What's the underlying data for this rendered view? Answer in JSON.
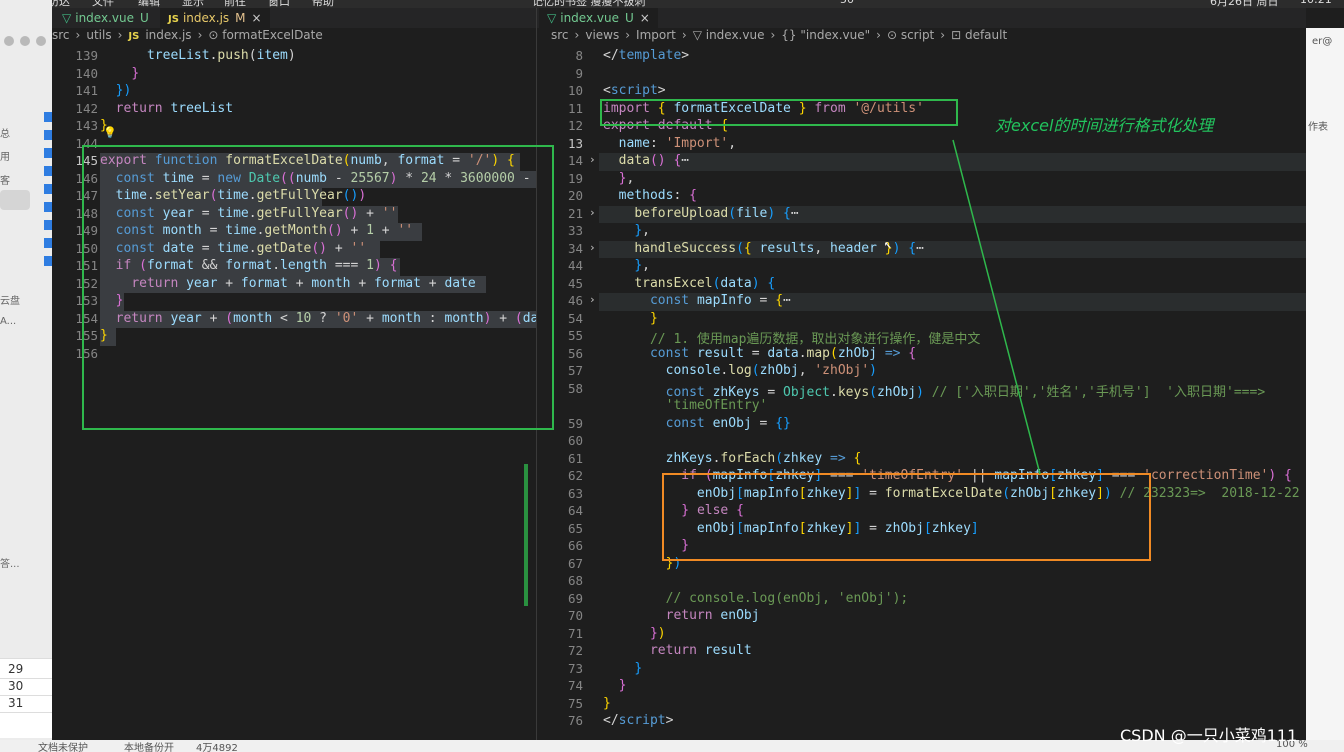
{
  "menubar": {
    "items": [
      "",
      "访达",
      "文件",
      "编辑",
      "显示",
      "前往",
      "窗口",
      "帮助",
      "记忆的书签 瘦瘦不拔刺",
      "50",
      "6月26日 周日",
      "10:21"
    ]
  },
  "left_bg_app": {
    "side_labels": [
      "总",
      "用",
      "客",
      "云盘",
      "A...",
      "答..."
    ],
    "row_numbers": [
      "29",
      "30",
      "31"
    ]
  },
  "right_bg_app": {
    "label_top": "er@",
    "label_mid": "作表"
  },
  "left_pane": {
    "tabs": [
      {
        "icon": "vue-icon",
        "label": "index.vue",
        "mod": "U"
      },
      {
        "icon": "js-icon",
        "label": "index.js",
        "mod": "M",
        "close": "×"
      }
    ],
    "breadcrumb": [
      "src",
      "›",
      "utils",
      "›",
      "JS",
      "index.js",
      "›",
      "⊙ formatExcelDate"
    ]
  },
  "right_pane": {
    "tabs": [
      {
        "icon": "vue-icon",
        "label": "index.vue",
        "mod": "U",
        "close": "×"
      }
    ],
    "breadcrumb": [
      "src",
      "›",
      "views",
      "›",
      "Import",
      "›",
      "▽ index.vue",
      "›",
      "{} \"index.vue\"",
      "›",
      "⊙ script",
      "›",
      "⊡ default"
    ]
  },
  "annotation": "对excel的时间进行格式化处理",
  "watermark": "CSDN @一只小菜鸡111",
  "statusbar": {
    "items": [
      "文档未保护",
      "本地备份开",
      "4万4892",
      "100 %"
    ]
  },
  "left_code": [
    {
      "n": "139",
      "html": "      <span class=\"vr\">treeList</span>.<span class=\"fn\">push</span>(<span class=\"vr\">item</span>)"
    },
    {
      "n": "140",
      "html": "    <span class=\"br2\">}</span>"
    },
    {
      "n": "141",
      "html": "  <span class=\"br3\">})</span>"
    },
    {
      "n": "142",
      "html": "  <span class=\"kw2\">return</span> <span class=\"vr\">treeList</span>"
    },
    {
      "n": "143",
      "html": "<span class=\"br\">}</span>"
    },
    {
      "n": "144",
      "html": ""
    },
    {
      "n": "145",
      "html": "<span class=\"kw2\">export</span> <span class=\"kw\">function</span> <span class=\"fn\">formatExcelDate</span><span class=\"br\">(</span><span class=\"vr\">numb</span>, <span class=\"vr\">format</span> = <span class=\"str\">'/'</span><span class=\"br\">)</span> <span class=\"br\">{</span>"
    },
    {
      "n": "146",
      "html": "  <span class=\"kw\">const</span> <span class=\"vr\">time</span> = <span class=\"kw\">new</span> <span class=\"cls\">Date</span><span class=\"br2\">((</span><span class=\"vr\">numb</span> - <span class=\"num\">25567</span><span class=\"br2\">)</span> * <span class=\"num\">24</span> * <span class=\"num\">3600000</span> -"
    },
    {
      "n": "147",
      "html": "  <span class=\"vr\">time</span>.<span class=\"fn\">setYear</span><span class=\"br2\">(</span><span class=\"vr\">time</span>.<span class=\"fn\">getFullYear</span><span class=\"br3\">()</span><span class=\"br2\">)</span>"
    },
    {
      "n": "148",
      "html": "  <span class=\"kw\">const</span> <span class=\"vr\">year</span> = <span class=\"vr\">time</span>.<span class=\"fn\">getFullYear</span><span class=\"br2\">()</span> + <span class=\"str\">''</span>"
    },
    {
      "n": "149",
      "html": "  <span class=\"kw\">const</span> <span class=\"vr\">month</span> = <span class=\"vr\">time</span>.<span class=\"fn\">getMonth</span><span class=\"br2\">()</span> + <span class=\"num\">1</span> + <span class=\"str\">''</span>"
    },
    {
      "n": "150",
      "html": "  <span class=\"kw\">const</span> <span class=\"vr\">date</span> = <span class=\"vr\">time</span>.<span class=\"fn\">getDate</span><span class=\"br2\">()</span> + <span class=\"str\">''</span>"
    },
    {
      "n": "151",
      "html": "  <span class=\"kw2\">if</span> <span class=\"br2\">(</span><span class=\"vr\">format</span> &amp;&amp; <span class=\"vr\">format</span>.<span class=\"vr\">length</span> === <span class=\"num\">1</span><span class=\"br2\">)</span> <span class=\"br2\">{</span>"
    },
    {
      "n": "152",
      "html": "    <span class=\"kw2\">return</span> <span class=\"vr\">year</span> + <span class=\"vr\">format</span> + <span class=\"vr\">month</span> + <span class=\"vr\">format</span> + <span class=\"vr\">date</span>"
    },
    {
      "n": "153",
      "html": "  <span class=\"br2\">}</span>"
    },
    {
      "n": "154",
      "html": "  <span class=\"kw2\">return</span> <span class=\"vr\">year</span> + <span class=\"br2\">(</span><span class=\"vr\">month</span> &lt; <span class=\"num\">10</span> ? <span class=\"str\">'0'</span> + <span class=\"vr\">month</span> : <span class=\"vr\">month</span><span class=\"br2\">)</span> + <span class=\"br2\">(</span><span class=\"vr\">da</span>"
    },
    {
      "n": "155",
      "html": "<span class=\"br\">}</span>"
    },
    {
      "n": "156",
      "html": ""
    }
  ],
  "right_code": [
    {
      "n": "8",
      "html": "<span class=\"pl\">&lt;/</span><span class=\"kw\">template</span><span class=\"pl\">&gt;</span>"
    },
    {
      "n": "9",
      "html": ""
    },
    {
      "n": "10",
      "html": "<span class=\"pl\">&lt;</span><span class=\"kw\">script</span><span class=\"pl\">&gt;</span>"
    },
    {
      "n": "11",
      "html": "<span class=\"kw2\">import</span> <span class=\"br\">{</span> <span class=\"vr\">formatExcelDate</span> <span class=\"br\">}</span> <span class=\"kw2\">from</span> <span class=\"str\">'@/utils'</span>"
    },
    {
      "n": "12",
      "html": "<span class=\"kw2\">export</span> <span class=\"kw2\">default</span> <span class=\"br\">{</span>"
    },
    {
      "n": "13",
      "html": "  <span class=\"vr\">name</span>: <span class=\"str\">'Import'</span>,"
    },
    {
      "n": "14",
      "html": "  <span class=\"fn\">data</span><span class=\"br2\">()</span> <span class=\"br2\">{</span><span class=\"pl\">⋯</span>"
    },
    {
      "n": "19",
      "html": "  <span class=\"br2\">}</span>,"
    },
    {
      "n": "20",
      "html": "  <span class=\"vr\">methods</span>: <span class=\"br2\">{</span>"
    },
    {
      "n": "21",
      "html": "    <span class=\"fn\">beforeUpload</span><span class=\"br3\">(</span><span class=\"vr\">file</span><span class=\"br3\">)</span> <span class=\"br3\">{</span><span class=\"pl\">⋯</span>"
    },
    {
      "n": "33",
      "html": "    <span class=\"br3\">}</span>,"
    },
    {
      "n": "34",
      "html": "    <span class=\"fn\">handleSuccess</span><span class=\"br3\">(</span><span class=\"br\">{</span> <span class=\"vr\">results</span>, <span class=\"vr\">header</span> <span class=\"br\">}</span><span class=\"br3\">)</span> <span class=\"br3\">{</span><span class=\"pl\">⋯</span>"
    },
    {
      "n": "44",
      "html": "    <span class=\"br3\">}</span>,"
    },
    {
      "n": "45",
      "html": "    <span class=\"fn\">transExcel</span><span class=\"br3\">(</span><span class=\"vr\">data</span><span class=\"br3\">)</span> <span class=\"br3\">{</span>"
    },
    {
      "n": "46",
      "html": "      <span class=\"kw\">const</span> <span class=\"vr\">mapInfo</span> = <span class=\"br\">{</span><span class=\"pl\">⋯</span>"
    },
    {
      "n": "54",
      "html": "      <span class=\"br\">}</span>"
    },
    {
      "n": "55",
      "html": "      <span class=\"cm\">// 1. 使用map遍历数据，取出对象进行操作，健是中文</span>"
    },
    {
      "n": "56",
      "html": "      <span class=\"kw\">const</span> <span class=\"vr\">result</span> = <span class=\"vr\">data</span>.<span class=\"fn\">map</span><span class=\"br\">(</span><span class=\"vr\">zhObj</span> <span class=\"kw\">=&gt;</span> <span class=\"br2\">{</span>"
    },
    {
      "n": "57",
      "html": "        <span class=\"vr\">console</span>.<span class=\"fn\">log</span><span class=\"br3\">(</span><span class=\"vr\">zhObj</span>, <span class=\"str\">'zhObj'</span><span class=\"br3\">)</span>"
    },
    {
      "n": "58",
      "html": "        <span class=\"kw\">const</span> <span class=\"vr\">zhKeys</span> = <span class=\"cls\">Object</span>.<span class=\"fn\">keys</span><span class=\"br3\">(</span><span class=\"vr\">zhObj</span><span class=\"br3\">)</span> <span class=\"cm\">// ['入职日期','姓名','手机号']  '入职日期'===&gt;</span>"
    },
    {
      "n": "",
      "html": "        <span class=\"cm\">'timeOfEntry'</span>"
    },
    {
      "n": "59",
      "html": "        <span class=\"kw\">const</span> <span class=\"vr\">enObj</span> = <span class=\"br3\">{}</span>"
    },
    {
      "n": "60",
      "html": ""
    },
    {
      "n": "61",
      "html": "        <span class=\"vr\">zhKeys</span>.<span class=\"fn\">forEach</span><span class=\"br3\">(</span><span class=\"vr\">zhkey</span> <span class=\"kw\">=&gt;</span> <span class=\"br\">{</span>"
    },
    {
      "n": "62",
      "html": "          <span class=\"kw2\">if</span> <span class=\"br2\">(</span><span class=\"vr\">mapInfo</span><span class=\"br3\">[</span><span class=\"vr\">zhkey</span><span class=\"br3\">]</span> === <span class=\"str\">'timeOfEntry'</span> || <span class=\"vr\">mapInfo</span><span class=\"br3\">[</span><span class=\"vr\">zhkey</span><span class=\"br3\">]</span> === <span class=\"str\">'correctionTime'</span><span class=\"br2\">)</span> <span class=\"br2\">{</span>"
    },
    {
      "n": "63",
      "html": "            <span class=\"vr\">enObj</span><span class=\"br3\">[</span><span class=\"vr\">mapInfo</span><span class=\"br\">[</span><span class=\"vr\">zhkey</span><span class=\"br\">]</span><span class=\"br3\">]</span> = <span class=\"fn\">formatExcelDate</span><span class=\"br3\">(</span><span class=\"vr\">zhObj</span><span class=\"br\">[</span><span class=\"vr\">zhkey</span><span class=\"br\">]</span><span class=\"br3\">)</span> <span class=\"cm\">// 232323=&gt;  2018-12-22</span>"
    },
    {
      "n": "64",
      "html": "          <span class=\"br2\">}</span> <span class=\"kw2\">else</span> <span class=\"br2\">{</span>"
    },
    {
      "n": "65",
      "html": "            <span class=\"vr\">enObj</span><span class=\"br3\">[</span><span class=\"vr\">mapInfo</span><span class=\"br\">[</span><span class=\"vr\">zhkey</span><span class=\"br\">]</span><span class=\"br3\">]</span> = <span class=\"vr\">zhObj</span><span class=\"br3\">[</span><span class=\"vr\">zhkey</span><span class=\"br3\">]</span>"
    },
    {
      "n": "66",
      "html": "          <span class=\"br2\">}</span>"
    },
    {
      "n": "67",
      "html": "        <span class=\"br\">}</span><span class=\"br3\">)</span>"
    },
    {
      "n": "68",
      "html": ""
    },
    {
      "n": "69",
      "html": "        <span class=\"cm\">// console.log(enObj, 'enObj');</span>"
    },
    {
      "n": "70",
      "html": "        <span class=\"kw2\">return</span> <span class=\"vr\">enObj</span>"
    },
    {
      "n": "71",
      "html": "      <span class=\"br2\">}</span><span class=\"br\">)</span>"
    },
    {
      "n": "72",
      "html": "      <span class=\"kw2\">return</span> <span class=\"vr\">result</span>"
    },
    {
      "n": "73",
      "html": "    <span class=\"br3\">}</span>"
    },
    {
      "n": "74",
      "html": "  <span class=\"br2\">}</span>"
    },
    {
      "n": "75",
      "html": "<span class=\"br\">}</span>"
    },
    {
      "n": "76",
      "html": "<span class=\"pl\">&lt;/</span><span class=\"kw\">script</span><span class=\"pl\">&gt;</span>"
    }
  ]
}
